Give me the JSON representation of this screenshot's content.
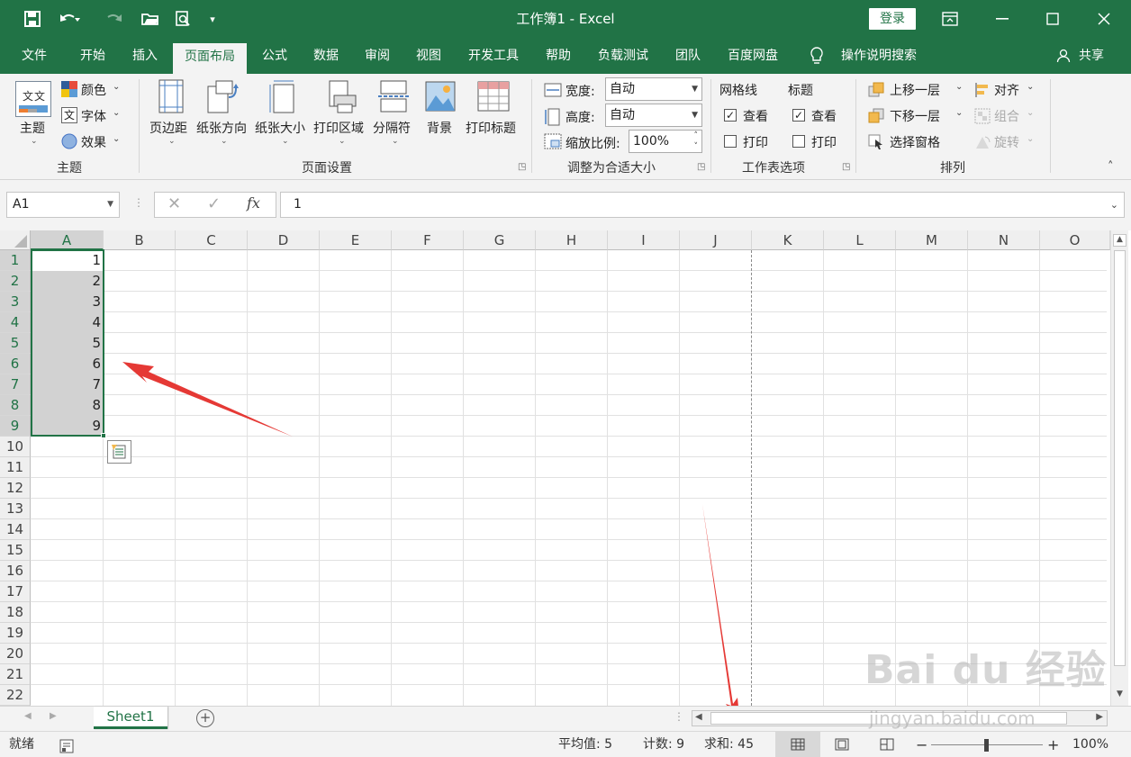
{
  "window": {
    "title": "工作簿1 - Excel",
    "login": "登录"
  },
  "tabs": [
    "文件",
    "开始",
    "插入",
    "页面布局",
    "公式",
    "数据",
    "审阅",
    "视图",
    "开发工具",
    "帮助",
    "负载测试",
    "团队",
    "百度网盘"
  ],
  "tell_me": "操作说明搜索",
  "share": "共享",
  "ribbon": {
    "theme": {
      "big": "主题",
      "colors": "颜色",
      "fonts": "字体",
      "effects": "效果",
      "label": "主题"
    },
    "page_setup": {
      "margins": "页边距",
      "orientation": "纸张方向",
      "size": "纸张大小",
      "print_area": "打印区域",
      "breaks": "分隔符",
      "background": "背景",
      "print_titles": "打印标题",
      "label": "页面设置"
    },
    "scale": {
      "width_label": "宽度:",
      "width_value": "自动",
      "height_label": "高度:",
      "height_value": "自动",
      "scale_label": "缩放比例:",
      "scale_value": "100%",
      "label": "调整为合适大小"
    },
    "sheet_options": {
      "gridlines": "网格线",
      "headings": "标题",
      "view": "查看",
      "print": "打印",
      "label": "工作表选项"
    },
    "arrange": {
      "bring_forward": "上移一层",
      "send_backward": "下移一层",
      "selection_pane": "选择窗格",
      "align": "对齐",
      "group": "组合",
      "rotate": "旋转",
      "label": "排列"
    }
  },
  "formula_bar": {
    "name_box": "A1",
    "fx": "fx",
    "value": "1"
  },
  "columns": [
    "A",
    "B",
    "C",
    "D",
    "E",
    "F",
    "G",
    "H",
    "I",
    "J",
    "K",
    "L",
    "M",
    "N",
    "O"
  ],
  "rows": [
    "1",
    "2",
    "3",
    "4",
    "5",
    "6",
    "7",
    "8",
    "9",
    "10",
    "11",
    "12",
    "13",
    "14",
    "15",
    "16",
    "17",
    "18",
    "19",
    "20",
    "21",
    "22"
  ],
  "cells_A": [
    "1",
    "2",
    "3",
    "4",
    "5",
    "6",
    "7",
    "8",
    "9"
  ],
  "sheet_tab": "Sheet1",
  "status": {
    "ready": "就绪",
    "average": "平均值: 5",
    "count": "计数: 9",
    "sum": "求和: 45",
    "zoom": "100%"
  },
  "watermark": {
    "main": "Bai du 经验",
    "sub": "jingyan.baidu.com"
  },
  "colors": {
    "excel_green": "#217346",
    "arrow_red": "#e53935"
  }
}
